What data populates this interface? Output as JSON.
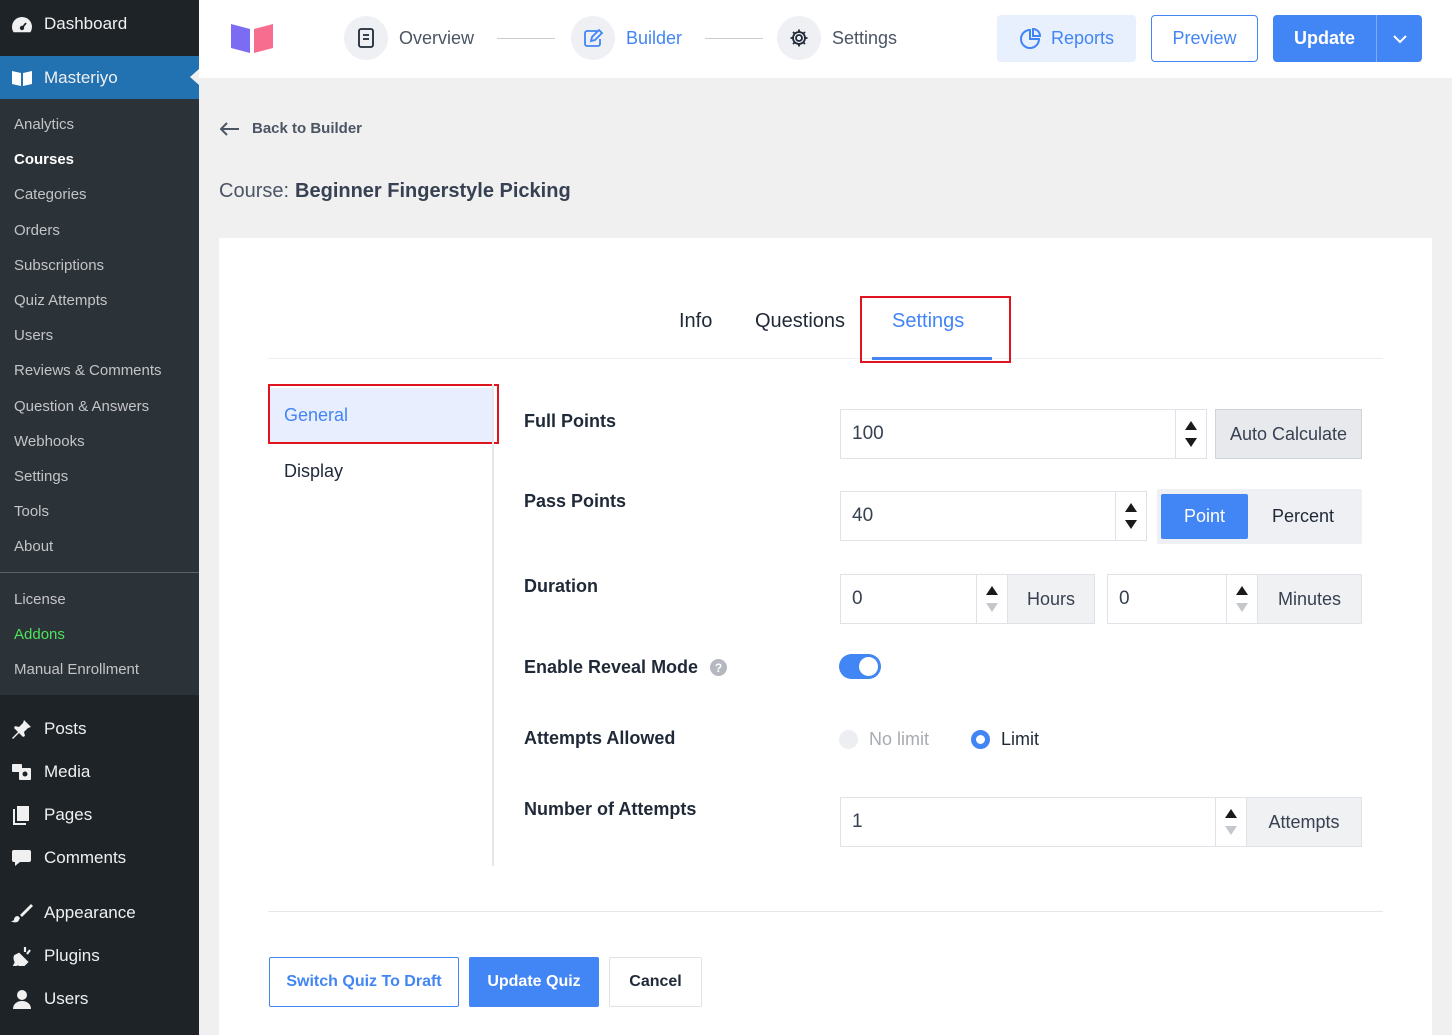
{
  "sidebar": {
    "dashboard": "Dashboard",
    "masteriyo": "Masteriyo",
    "submenu": [
      "Analytics",
      "Courses",
      "Categories",
      "Orders",
      "Subscriptions",
      "Quiz Attempts",
      "Users",
      "Reviews & Comments",
      "Question & Answers",
      "Webhooks",
      "Settings",
      "Tools",
      "About"
    ],
    "submenu2": [
      "License",
      "Addons",
      "Manual Enrollment"
    ],
    "main": [
      "Posts",
      "Media",
      "Pages",
      "Comments",
      "Appearance",
      "Plugins",
      "Users"
    ]
  },
  "topbar": {
    "steps": {
      "overview": "Overview",
      "builder": "Builder",
      "settings": "Settings"
    },
    "reports": "Reports",
    "preview": "Preview",
    "update": "Update"
  },
  "back_label": "Back to Builder",
  "course": {
    "prefix": "Course:",
    "name": "Beginner Fingerstyle Picking"
  },
  "tabs": {
    "info": "Info",
    "questions": "Questions",
    "settings": "Settings"
  },
  "nav": {
    "general": "General",
    "display": "Display"
  },
  "fields": {
    "full_points": {
      "label": "Full Points",
      "value": "100",
      "addon": "Auto Calculate"
    },
    "pass_points": {
      "label": "Pass Points",
      "value": "40",
      "point": "Point",
      "percent": "Percent"
    },
    "duration": {
      "label": "Duration",
      "hours_value": "0",
      "hours": "Hours",
      "minutes_value": "0",
      "minutes": "Minutes"
    },
    "reveal_mode": {
      "label": "Enable Reveal Mode",
      "help": "?",
      "enabled": true
    },
    "attempts_allowed": {
      "label": "Attempts Allowed",
      "no_limit": "No limit",
      "limit": "Limit",
      "selected": "Limit"
    },
    "num_attempts": {
      "label": "Number of Attempts",
      "value": "1",
      "addon": "Attempts"
    }
  },
  "footer": {
    "draft": "Switch Quiz To Draft",
    "update": "Update Quiz",
    "cancel": "Cancel"
  },
  "colors": {
    "accent": "#4285f4",
    "highlight_border": "#e0141e",
    "wp_sidebar": "#1d2327",
    "wp_active": "#2271b1",
    "addons_green": "#4ee25c"
  }
}
